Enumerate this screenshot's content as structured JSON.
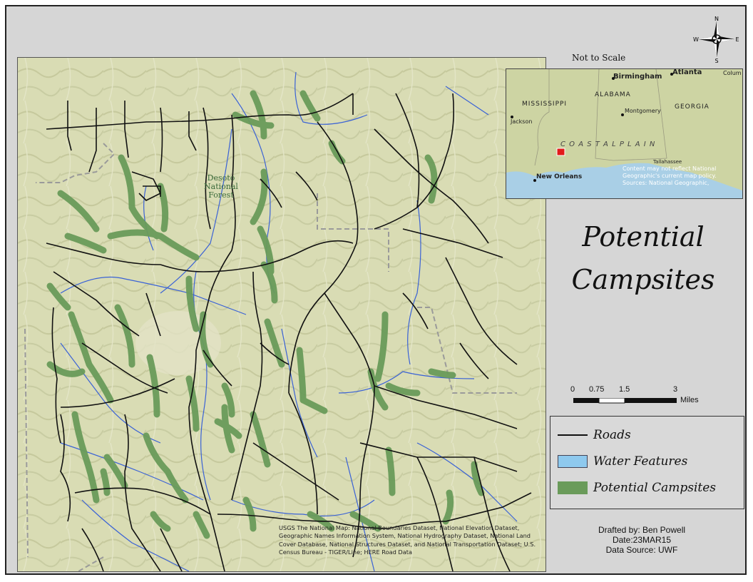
{
  "map": {
    "title_line1": "Potential",
    "title_line2": "Campsites",
    "not_to_scale": "Not to Scale",
    "forest_label": [
      "Desoto",
      "National",
      "Forest"
    ],
    "credits": "USGS The National Map: National Boundaries Dataset, National Elevation Dataset, Geographic Names Information System, National Hydrography Dataset, National Land Cover Database, National Structures Dataset, and National Transportation Dataset; U.S. Census Bureau - TIGER/Line; HERE Road Data"
  },
  "north_arrow": {
    "n": "N",
    "s": "S",
    "e": "E",
    "w": "W"
  },
  "inset": {
    "places": {
      "birmingham": "Birmingham",
      "atlanta": "Atlanta",
      "columbus": "Colum",
      "alabama": "ALABAMA",
      "mississippi": "MISSISSIPPI",
      "georgia": "GEORGIA",
      "montgomery": "Montgomery",
      "jackson": "Jackson",
      "coastal_plain": "C O A S T A L     P L A I N",
      "new_orleans": "New Orleans",
      "tallahassee": "Tallahassee"
    },
    "notice_lines": [
      "Content may not reflect National",
      "Geographic's current map policy.",
      "Sources: National Geographic,"
    ]
  },
  "scalebar": {
    "ticks": [
      "0",
      "0.75",
      "1.5",
      "3"
    ],
    "unit": "Miles"
  },
  "legend": {
    "items": [
      {
        "label": "Roads",
        "kind": "line",
        "color": "#111111"
      },
      {
        "label": "Water Features",
        "kind": "fill",
        "color": "#8ec9ee"
      },
      {
        "label": "Potential Campsites",
        "kind": "fill",
        "color": "#6a9b5a"
      }
    ]
  },
  "meta": {
    "drafted_by": "Drafted by: Ben Powell",
    "date": "Date:23MAR15",
    "source": "Data Source: UWF"
  },
  "colors": {
    "terrain": "#d9dcb4",
    "water": "#3a62d6",
    "roads": "#111111",
    "campsites": "#6a9b5a",
    "boundary": "#9a9a9a"
  }
}
